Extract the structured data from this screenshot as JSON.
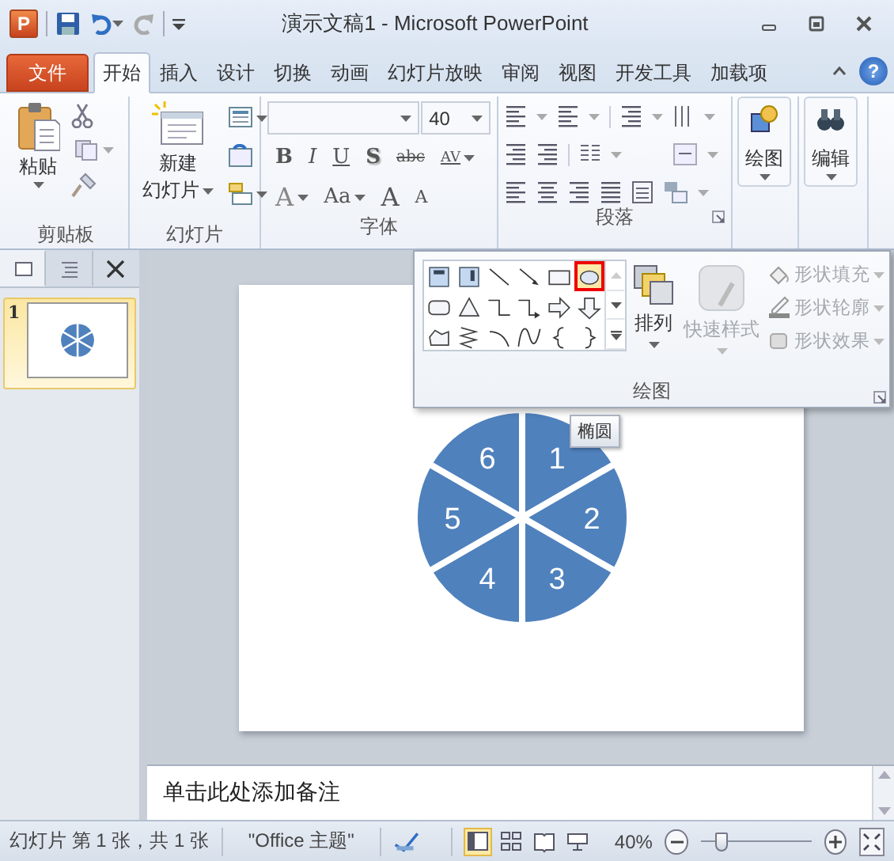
{
  "window": {
    "app_letter": "P",
    "title": "演示文稿1 - Microsoft PowerPoint"
  },
  "tabs": [
    {
      "label": "文件",
      "kind": "file",
      "selected": false
    },
    {
      "label": "开始",
      "kind": "tab",
      "selected": true
    },
    {
      "label": "插入",
      "kind": "tab",
      "selected": false
    },
    {
      "label": "设计",
      "kind": "tab",
      "selected": false
    },
    {
      "label": "切换",
      "kind": "tab",
      "selected": false
    },
    {
      "label": "动画",
      "kind": "tab",
      "selected": false
    },
    {
      "label": "幻灯片放映",
      "kind": "tab",
      "selected": false
    },
    {
      "label": "审阅",
      "kind": "tab",
      "selected": false
    },
    {
      "label": "视图",
      "kind": "tab",
      "selected": false
    },
    {
      "label": "开发工具",
      "kind": "tab",
      "selected": false
    },
    {
      "label": "加载项",
      "kind": "tab",
      "selected": false
    }
  ],
  "help": "?",
  "ribbon": {
    "clipboard": {
      "label": "剪贴板",
      "paste": "粘贴"
    },
    "slides": {
      "label": "幻灯片",
      "new_slide": [
        "新建",
        "幻灯片"
      ]
    },
    "font": {
      "label": "字体",
      "size": "40",
      "style_buttons": [
        {
          "label": "B",
          "kind": "bold"
        },
        {
          "label": "I",
          "kind": "italic"
        },
        {
          "label": "U",
          "kind": "underline"
        },
        {
          "label": "S",
          "kind": "shadow"
        },
        {
          "label": "abc",
          "kind": "strike"
        },
        {
          "label": "AV",
          "kind": "spacing"
        }
      ],
      "size_buttons": [
        {
          "label": "A",
          "kind": "color"
        },
        {
          "label": "Aa",
          "kind": "case"
        },
        {
          "label": "A",
          "kind": "grow"
        },
        {
          "label": "A",
          "kind": "shrink"
        }
      ]
    },
    "paragraph": {
      "label": "段落"
    },
    "drawing": "绘图",
    "editing": "编辑"
  },
  "drawing_panel": {
    "shapes": [
      {
        "kind": "textbox",
        "selected": false
      },
      {
        "kind": "vertical-textbox",
        "selected": false
      },
      {
        "kind": "line",
        "selected": false
      },
      {
        "kind": "arrow",
        "selected": false
      },
      {
        "kind": "rectangle",
        "selected": false
      },
      {
        "kind": "oval",
        "selected": true
      },
      {
        "kind": "rounded-rectangle",
        "selected": false
      },
      {
        "kind": "triangle",
        "selected": false
      },
      {
        "kind": "elbow",
        "selected": false
      },
      {
        "kind": "elbow-arrow",
        "selected": false
      },
      {
        "kind": "right-arrow",
        "selected": false
      },
      {
        "kind": "down-arrow",
        "selected": false
      },
      {
        "kind": "freeform",
        "selected": false
      },
      {
        "kind": "scribble",
        "selected": false
      },
      {
        "kind": "arc",
        "selected": false
      },
      {
        "kind": "curve",
        "selected": false
      },
      {
        "kind": "left-brace",
        "selected": false
      },
      {
        "kind": "right-brace",
        "selected": false
      }
    ],
    "arrange": "排列",
    "quick_styles": {
      "label": "快速样式",
      "disabled": true
    },
    "format": [
      {
        "label": "形状填充",
        "kind": "fill",
        "disabled": true
      },
      {
        "label": "形状轮廓",
        "kind": "outline",
        "disabled": true
      },
      {
        "label": "形状效果",
        "kind": "effects",
        "disabled": true
      }
    ],
    "label": "绘图",
    "tooltip": "椭圆"
  },
  "panel_tabs": [
    {
      "kind": "slides",
      "selected": true
    },
    {
      "kind": "outline",
      "selected": false
    }
  ],
  "thumbnails": [
    {
      "number": "1",
      "selected": true
    }
  ],
  "slide": {
    "segments": [
      "1",
      "2",
      "3",
      "4",
      "5",
      "6"
    ]
  },
  "notes": {
    "placeholder": "单击此处添加备注"
  },
  "status_bar": {
    "slide": "幻灯片 第 1 张，共 1 张",
    "theme": "\"Office 主题\"",
    "views": [
      {
        "kind": "normal",
        "selected": true
      },
      {
        "kind": "sorter",
        "selected": false
      },
      {
        "kind": "reading",
        "selected": false
      },
      {
        "kind": "show",
        "selected": false
      }
    ],
    "zoom": "40%",
    "level": 0.19
  }
}
